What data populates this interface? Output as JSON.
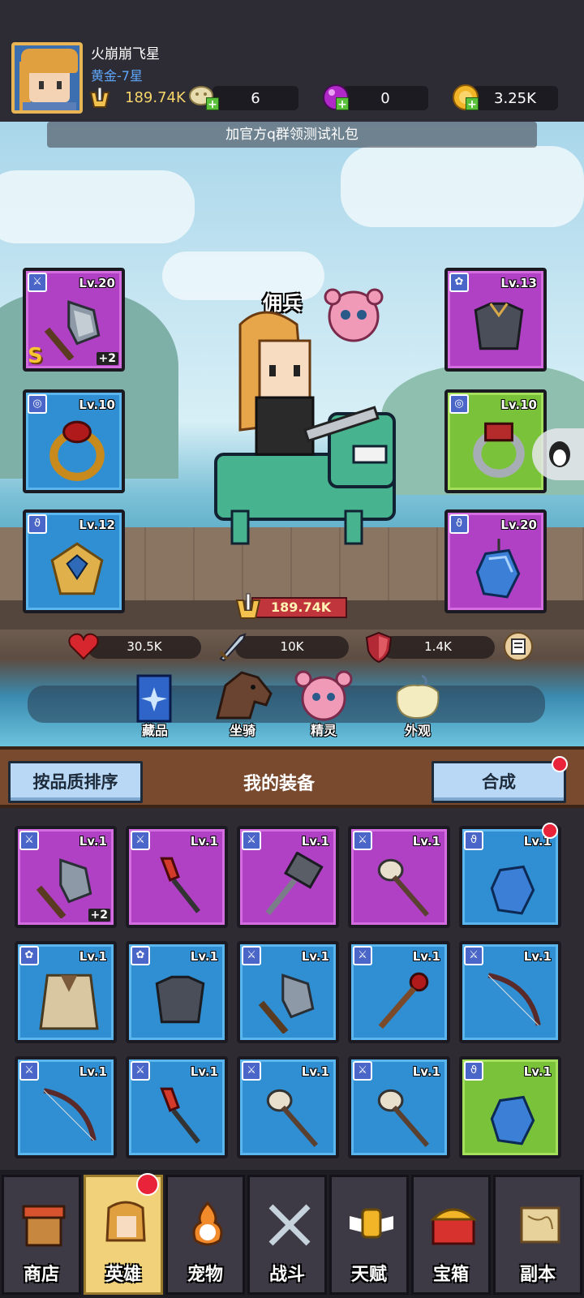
{
  "player": {
    "name": "火崩崩飞星",
    "rank": "黄金-7星",
    "power": "189.74K"
  },
  "resources": {
    "bones": "6",
    "gems": "0",
    "gold": "3.25K"
  },
  "banner": "加官方q群领测试礼包",
  "hero": {
    "label": "佣兵",
    "power": "189.74K",
    "stats": {
      "hp": "30.5K",
      "attack": "10K",
      "defense": "1.4K"
    }
  },
  "equipped": {
    "left": [
      {
        "level": "Lv.20",
        "plus": "+2",
        "grade": "S",
        "item": "axe-icon",
        "rarity": "purple"
      },
      {
        "level": "Lv.10",
        "item": "ruby-ring-icon",
        "rarity": "blue"
      },
      {
        "level": "Lv.12",
        "item": "diamond-necklace-icon",
        "rarity": "blue"
      }
    ],
    "right": [
      {
        "level": "Lv.13",
        "item": "armor-icon",
        "rarity": "purple"
      },
      {
        "level": "Lv.10",
        "item": "silver-ring-icon",
        "rarity": "green"
      },
      {
        "level": "Lv.20",
        "item": "crystal-pendant-icon",
        "rarity": "purple"
      }
    ]
  },
  "sub_tabs": [
    "藏品",
    "坐骑",
    "精灵",
    "外观"
  ],
  "equip_panel": {
    "sort_label": "按品质排序",
    "title": "我的装备",
    "combine_label": "合成"
  },
  "inventory": [
    {
      "level": "Lv.1",
      "plus": "+2",
      "item": "axe-icon",
      "rarity": "purple"
    },
    {
      "level": "Lv.1",
      "item": "red-dagger-icon",
      "rarity": "purple"
    },
    {
      "level": "Lv.1",
      "item": "hammer-icon",
      "rarity": "purple"
    },
    {
      "level": "Lv.1",
      "item": "skull-staff-icon",
      "rarity": "purple"
    },
    {
      "level": "Lv.1",
      "item": "crystal-pendant-icon",
      "rarity": "blue"
    },
    {
      "level": "Lv.1",
      "item": "cloak-icon",
      "rarity": "blue"
    },
    {
      "level": "Lv.1",
      "item": "armor-icon",
      "rarity": "blue"
    },
    {
      "level": "Lv.1",
      "item": "axe-icon",
      "rarity": "blue"
    },
    {
      "level": "Lv.1",
      "item": "red-staff-icon",
      "rarity": "blue"
    },
    {
      "level": "Lv.1",
      "item": "bow-icon",
      "rarity": "blue"
    },
    {
      "level": "Lv.1",
      "item": "bow-icon",
      "rarity": "blue"
    },
    {
      "level": "Lv.1",
      "item": "red-dagger-icon",
      "rarity": "blue"
    },
    {
      "level": "Lv.1",
      "item": "skull-staff-icon",
      "rarity": "blue"
    },
    {
      "level": "Lv.1",
      "item": "skull-staff-icon",
      "rarity": "blue"
    },
    {
      "level": "Lv.1",
      "item": "crystal-pendant-icon",
      "rarity": "green"
    }
  ],
  "nav": [
    "商店",
    "英雄",
    "宠物",
    "战斗",
    "天赋",
    "宝箱",
    "副本"
  ],
  "colors": {
    "purple": "#b040c4",
    "blue": "#2f8fd2",
    "green": "#7ac23a",
    "accent": "#f1d27a"
  }
}
